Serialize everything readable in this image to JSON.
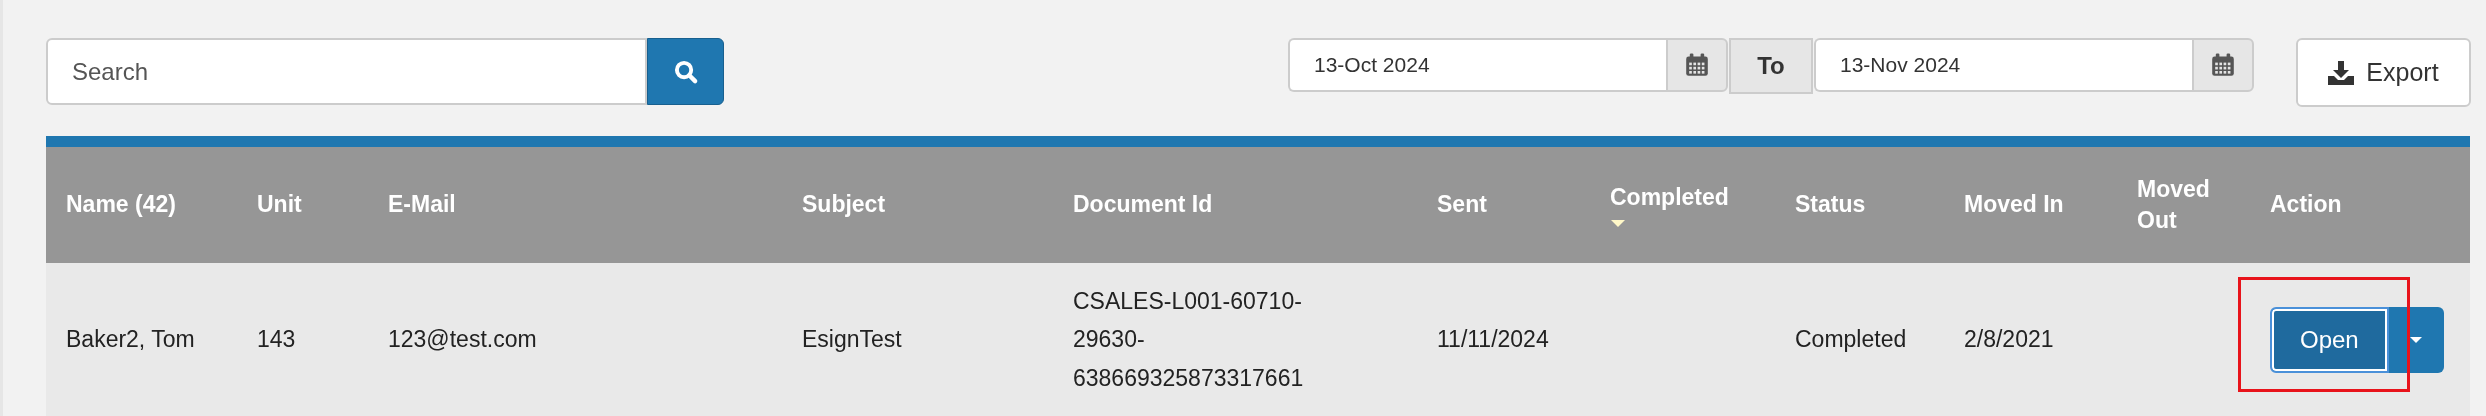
{
  "toolbar": {
    "search": {
      "placeholder": "Search"
    },
    "date_from": {
      "value": "13-Oct 2024"
    },
    "range_label": "To",
    "date_to": {
      "value": "13-Nov 2024"
    },
    "export_button": "Export"
  },
  "table": {
    "columns": [
      {
        "label": "Name (42)",
        "sorted": false
      },
      {
        "label": "Unit",
        "sorted": false
      },
      {
        "label": "E-Mail",
        "sorted": false
      },
      {
        "label": "Subject",
        "sorted": false
      },
      {
        "label": "Document Id",
        "sorted": false
      },
      {
        "label": "Sent",
        "sorted": false
      },
      {
        "label": "Completed",
        "sorted": true
      },
      {
        "label": "Status",
        "sorted": false
      },
      {
        "label": "Moved In",
        "sorted": false
      },
      {
        "label": "Moved Out",
        "sorted": false
      },
      {
        "label": "Action",
        "sorted": false
      }
    ],
    "rows": [
      {
        "cells": [
          "Baker2, Tom",
          "143",
          "123@test.com",
          "EsignTest",
          "CSALES-L001-60710-29630-638669325873317661",
          "11/11/2024",
          "",
          "Completed",
          "2/8/2021",
          ""
        ],
        "action": {
          "label": "Open",
          "highlighted": true
        }
      }
    ]
  }
}
